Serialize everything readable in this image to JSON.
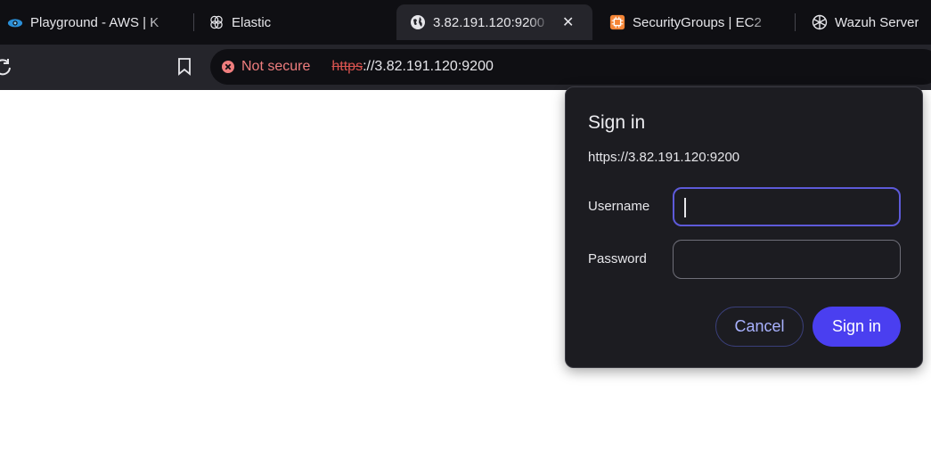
{
  "tabs": [
    {
      "title": "Playground - AWS | K",
      "icon": "aws-playground-icon",
      "active": false
    },
    {
      "title": "Elastic",
      "icon": "elastic-icon",
      "active": false
    },
    {
      "title": "3.82.191.120:9200",
      "icon": "globe-icon",
      "active": true
    },
    {
      "title": "SecurityGroups | EC2",
      "icon": "aws-ec2-icon",
      "active": false
    },
    {
      "title": "Wazuh Server",
      "icon": "openai-icon",
      "active": false
    }
  ],
  "toolbar": {
    "security_label": "Not secure",
    "url_scheme": "https",
    "url_rest": "://3.82.191.120:9200"
  },
  "dialog": {
    "title": "Sign in",
    "origin": "https://3.82.191.120:9200",
    "username_label": "Username",
    "username_value": "",
    "password_label": "Password",
    "password_value": "",
    "cancel_label": "Cancel",
    "signin_label": "Sign in"
  },
  "colors": {
    "tabstrip_bg": "#0f0f13",
    "toolbar_bg": "#25252b",
    "dialog_bg": "#1c1c21",
    "accent": "#4a3ff0",
    "insecure": "#f07e7e"
  }
}
